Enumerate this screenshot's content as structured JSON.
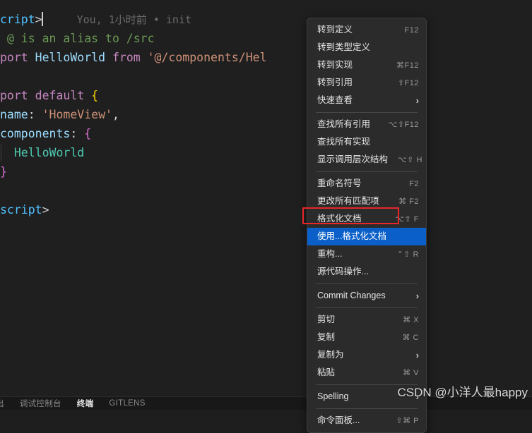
{
  "editor": {
    "blame_annotation": "You, 1小时前 • init",
    "lines": [
      {
        "id": "l1",
        "tokens": [
          {
            "t": "cript",
            "c": "tok-tag"
          },
          {
            "t": ">",
            "c": "tok-punct"
          }
        ],
        "caret": true,
        "blame": "You, 1小时前 • init"
      },
      {
        "id": "l2",
        "tokens": [
          {
            "t": " @ is an alias to /src",
            "c": "tok-comment"
          }
        ]
      },
      {
        "id": "l3",
        "tokens": [
          {
            "t": "port ",
            "c": "tok-kw"
          },
          {
            "t": "HelloWorld ",
            "c": "tok-ident"
          },
          {
            "t": "from ",
            "c": "tok-kw"
          },
          {
            "t": "'@/components/Hel",
            "c": "tok-str"
          }
        ]
      },
      {
        "id": "l4",
        "tokens": []
      },
      {
        "id": "l5",
        "tokens": [
          {
            "t": "port default ",
            "c": "tok-kw"
          },
          {
            "t": "{",
            "c": "tok-brace-y"
          }
        ]
      },
      {
        "id": "l6",
        "tokens": [
          {
            "t": "name",
            "c": "tok-prop"
          },
          {
            "t": ": ",
            "c": "tok-plain"
          },
          {
            "t": "'HomeView'",
            "c": "tok-str"
          },
          {
            "t": ",",
            "c": "tok-plain"
          }
        ]
      },
      {
        "id": "l7",
        "tokens": [
          {
            "t": "components",
            "c": "tok-prop"
          },
          {
            "t": ": ",
            "c": "tok-plain"
          },
          {
            "t": "{",
            "c": "tok-brace-p"
          }
        ]
      },
      {
        "id": "l8",
        "indent": true,
        "tokens": [
          {
            "t": "  HelloWorld",
            "c": "tok-fn"
          }
        ]
      },
      {
        "id": "l9",
        "tokens": [
          {
            "t": "}",
            "c": "tok-brace-p"
          }
        ]
      },
      {
        "id": "l10",
        "tokens": []
      },
      {
        "id": "l11",
        "tokens": [
          {
            "t": "script",
            "c": "tok-tag"
          },
          {
            "t": ">",
            "c": "tok-punct"
          }
        ]
      }
    ]
  },
  "context_menu": {
    "groups": [
      {
        "items": [
          {
            "label": "转到定义",
            "shortcut": "F12",
            "submenu": false,
            "selected": false
          },
          {
            "label": "转到类型定义",
            "shortcut": "",
            "submenu": false,
            "selected": false
          },
          {
            "label": "转到实现",
            "shortcut": "⌘F12",
            "submenu": false,
            "selected": false
          },
          {
            "label": "转到引用",
            "shortcut": "⇧F12",
            "submenu": false,
            "selected": false
          },
          {
            "label": "快速查看",
            "shortcut": "",
            "submenu": true,
            "selected": false
          }
        ]
      },
      {
        "items": [
          {
            "label": "查找所有引用",
            "shortcut": "⌥⇧F12",
            "submenu": false,
            "selected": false
          },
          {
            "label": "查找所有实现",
            "shortcut": "",
            "submenu": false,
            "selected": false
          },
          {
            "label": "显示调用层次结构",
            "shortcut": "⌥⇧ H",
            "submenu": false,
            "selected": false
          }
        ]
      },
      {
        "items": [
          {
            "label": "重命名符号",
            "shortcut": "F2",
            "submenu": false,
            "selected": false
          },
          {
            "label": "更改所有匹配项",
            "shortcut": "⌘ F2",
            "submenu": false,
            "selected": false
          },
          {
            "label": "格式化文档",
            "shortcut": "⌥⇧ F",
            "submenu": false,
            "selected": false
          },
          {
            "label": "使用...格式化文档",
            "shortcut": "",
            "submenu": false,
            "selected": true
          },
          {
            "label": "重构...",
            "shortcut": "⌃⇧ R",
            "submenu": false,
            "selected": false
          },
          {
            "label": "源代码操作...",
            "shortcut": "",
            "submenu": false,
            "selected": false
          }
        ]
      },
      {
        "items": [
          {
            "label": "Commit Changes",
            "shortcut": "",
            "submenu": true,
            "selected": false,
            "latin": true
          }
        ]
      },
      {
        "items": [
          {
            "label": "剪切",
            "shortcut": "⌘ X",
            "submenu": false,
            "selected": false
          },
          {
            "label": "复制",
            "shortcut": "⌘ C",
            "submenu": false,
            "selected": false
          },
          {
            "label": "复制为",
            "shortcut": "",
            "submenu": true,
            "selected": false
          },
          {
            "label": "粘贴",
            "shortcut": "⌘ V",
            "submenu": false,
            "selected": false
          }
        ]
      },
      {
        "items": [
          {
            "label": "Spelling",
            "shortcut": "",
            "submenu": true,
            "selected": false,
            "latin": true
          }
        ]
      },
      {
        "items": [
          {
            "label": "命令面板...",
            "shortcut": "⇧⌘ P",
            "submenu": false,
            "selected": false
          }
        ]
      }
    ]
  },
  "panel": {
    "tabs": [
      {
        "label": "出",
        "active": false,
        "clipped": true
      },
      {
        "label": "调试控制台",
        "active": false
      },
      {
        "label": "终端",
        "active": true
      },
      {
        "label": "GITLENS",
        "active": false
      }
    ]
  },
  "watermark": {
    "text": "CSDN @小洋人最happy"
  },
  "colors": {
    "menu_bg": "#2b2b2b",
    "menu_selected": "#0a60c8",
    "annotation_red": "#e8262b",
    "editor_bg": "#1f1f1f",
    "panel_bg": "#181818"
  }
}
